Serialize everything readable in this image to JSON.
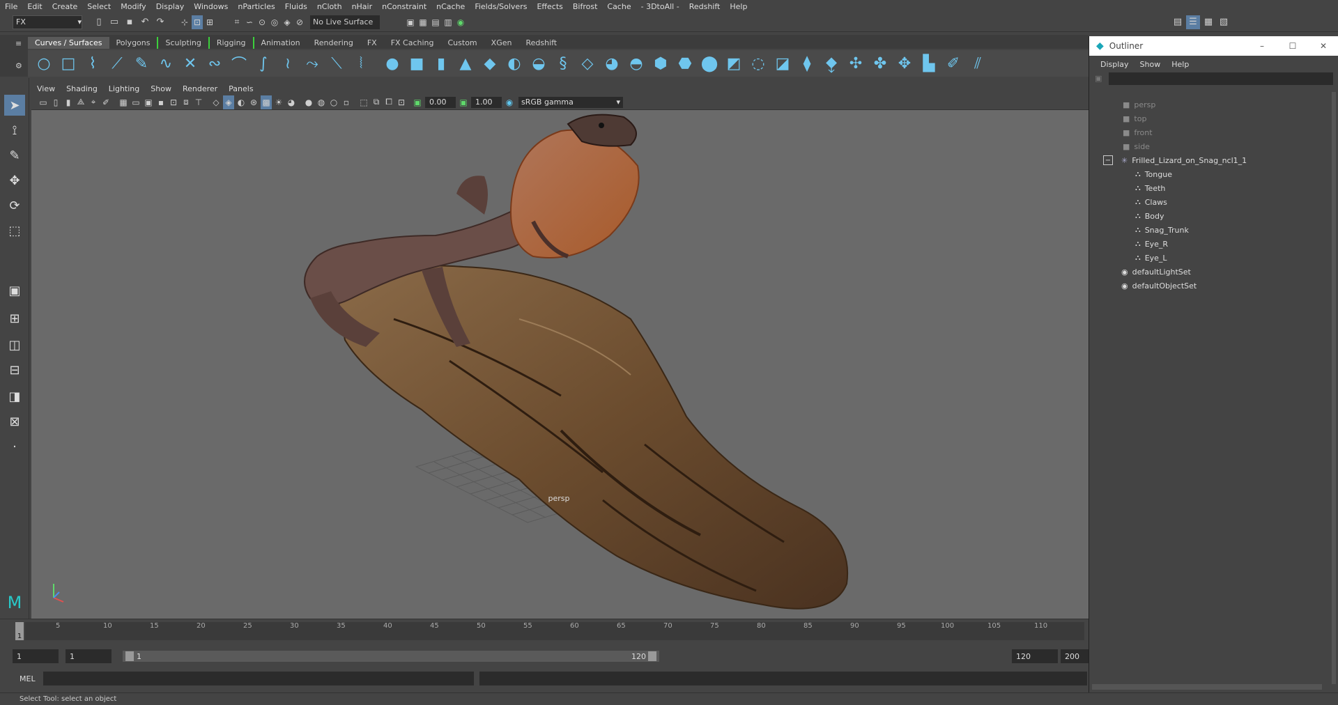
{
  "menubar": {
    "items": [
      "File",
      "Edit",
      "Create",
      "Select",
      "Modify",
      "Display",
      "Windows",
      "nParticles",
      "Fluids",
      "nCloth",
      "nHair",
      "nConstraint",
      "nCache",
      "Fields/Solvers",
      "Effects",
      "Bifrost",
      "Cache",
      "- 3DtoAll -",
      "Redshift",
      "Help"
    ]
  },
  "statusline": {
    "mode": "FX",
    "live_surface": "No Live Surface"
  },
  "shelf": {
    "tabs": [
      "Curves / Surfaces",
      "Polygons",
      "Sculpting",
      "Rigging",
      "Animation",
      "Rendering",
      "FX",
      "FX Caching",
      "Custom",
      "XGen",
      "Redshift"
    ],
    "active_tab": "Curves / Surfaces"
  },
  "panel": {
    "menu": [
      "View",
      "Shading",
      "Lighting",
      "Show",
      "Renderer",
      "Panels"
    ],
    "exposure": "0.00",
    "gamma": "1.00",
    "color_space": "sRGB gamma",
    "camera_label": "persp"
  },
  "timeline": {
    "current_frame": "1",
    "ticks": [
      "5",
      "10",
      "15",
      "20",
      "25",
      "30",
      "35",
      "40",
      "45",
      "50",
      "55",
      "60",
      "65",
      "70",
      "75",
      "80",
      "85",
      "90",
      "95",
      "100",
      "105",
      "110"
    ],
    "range_start": "1",
    "playback_start": "1",
    "slider_start": "1",
    "slider_end": "120",
    "playback_end": "120",
    "range_end": "200"
  },
  "command_line": {
    "label": "MEL"
  },
  "help_line": "Select Tool: select an object",
  "outliner": {
    "title": "Outliner",
    "menu": [
      "Display",
      "Show",
      "Help"
    ],
    "cameras": [
      "persp",
      "top",
      "front",
      "side"
    ],
    "group": "Frilled_Lizard_on_Snag_ncl1_1",
    "children": [
      "Tongue",
      "Teeth",
      "Claws",
      "Body",
      "Snag_Trunk",
      "Eye_R",
      "Eye_L"
    ],
    "sets": [
      "defaultLightSet",
      "defaultObjectSet"
    ]
  }
}
